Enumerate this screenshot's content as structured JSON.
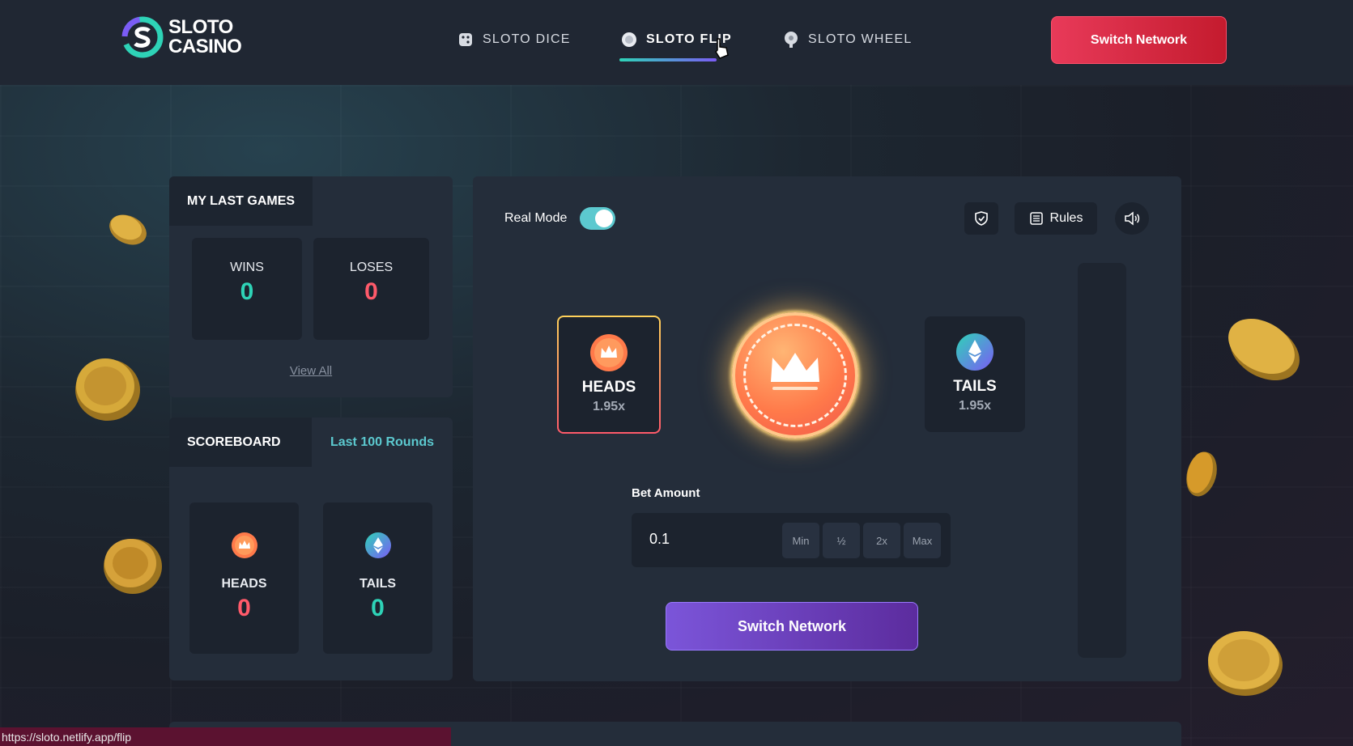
{
  "header": {
    "logo_line1": "SLOTO",
    "logo_line2": "CASINO",
    "nav": [
      {
        "label": "SLOTO DICE",
        "icon": "dice-icon"
      },
      {
        "label": "SLOTO FLIP",
        "icon": "coin-icon",
        "active": true
      },
      {
        "label": "SLOTO WHEEL",
        "icon": "wheel-icon"
      }
    ],
    "switch_network": "Switch Network"
  },
  "last_games": {
    "title": "MY LAST GAMES",
    "wins_label": "WINS",
    "wins_value": "0",
    "loses_label": "LOSES",
    "loses_value": "0",
    "view_all": "View All"
  },
  "scoreboard": {
    "title": "SCOREBOARD",
    "tab": "Last 100 Rounds",
    "heads_label": "HEADS",
    "heads_value": "0",
    "tails_label": "TAILS",
    "tails_value": "0"
  },
  "game": {
    "mode_label": "Real Mode",
    "rules_label": "Rules",
    "heads": {
      "name": "HEADS",
      "multiplier": "1.95x"
    },
    "tails": {
      "name": "TAILS",
      "multiplier": "1.95x"
    },
    "bet_label": "Bet Amount",
    "bet_value": "0.1",
    "bet_buttons": [
      "Min",
      "½",
      "2x",
      "Max"
    ],
    "switch_network": "Switch Network"
  },
  "status_bar": {
    "url": "https://sloto.netlify.app/flip"
  },
  "colors": {
    "accent_green": "#2ed3b7",
    "accent_red": "#ff5a6a",
    "purple": "#7b55d9"
  }
}
